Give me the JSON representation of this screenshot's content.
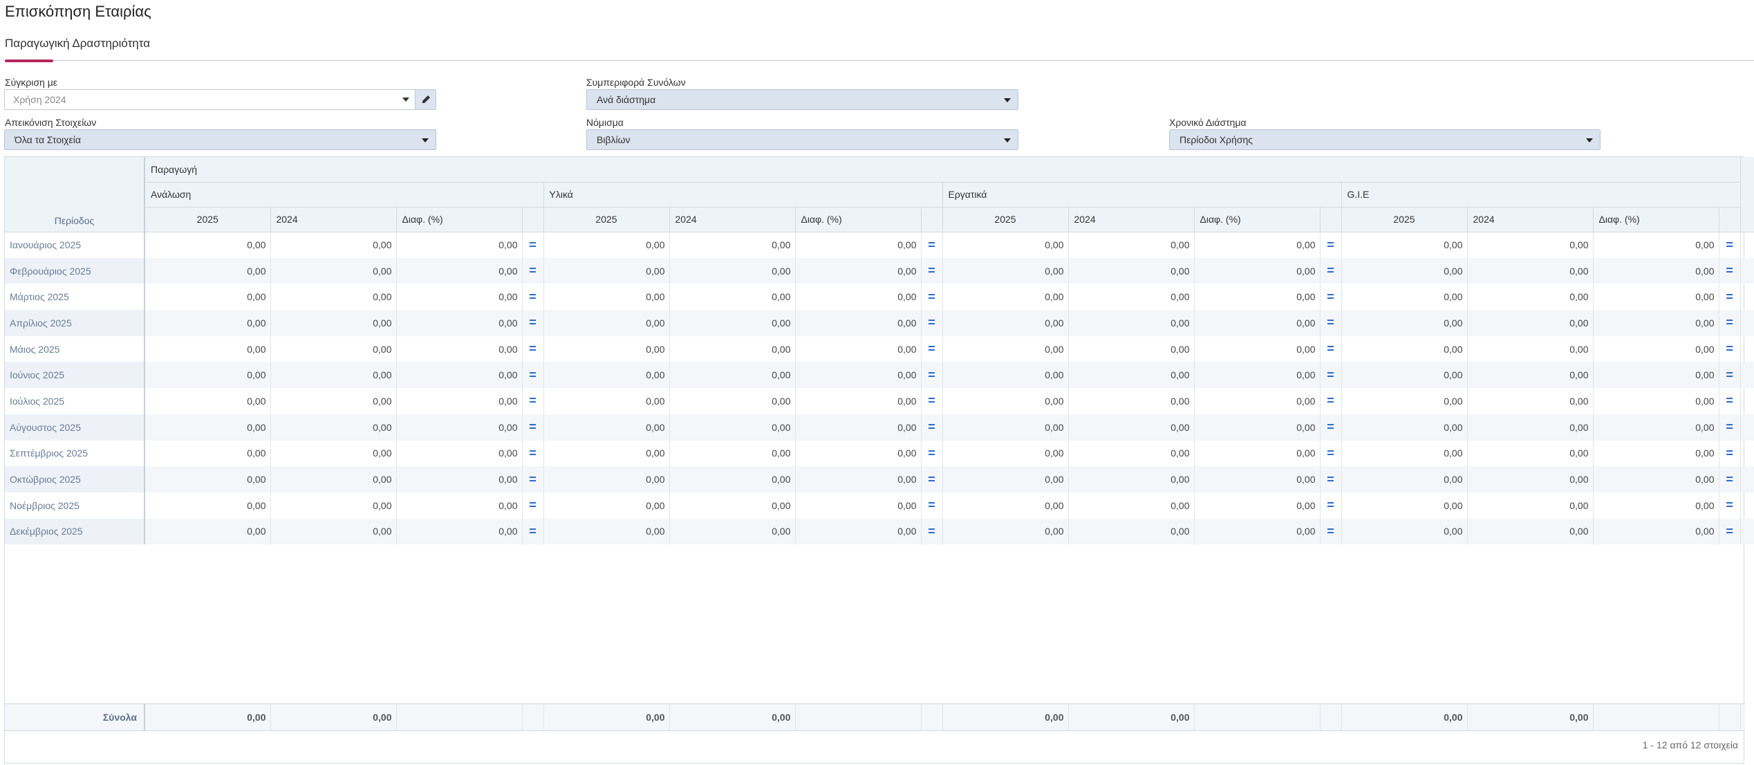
{
  "page_title": "Επισκόπηση Εταιρίας",
  "tab": "Παραγωγική Δραστηριότητα",
  "filters": {
    "compare_label": "Σύγκριση με",
    "compare_value": "Χρήση 2024",
    "totals_behavior_label": "Συμπεριφορά Συνόλων",
    "totals_behavior_value": "Ανά διάστημα",
    "display_items_label": "Απεικόνιση Στοιχείων",
    "display_items_value": "Όλα τα Στοιχεία",
    "currency_label": "Νόμισμα",
    "currency_value": "Βιβλίων",
    "period_label": "Χρονικό Διάστημα",
    "period_value": "Περίοδοι Χρήσης"
  },
  "grid": {
    "group": "Παραγωγή",
    "period_header": "Περίοδος",
    "sections": [
      "Ανάλωση",
      "Υλικά",
      "Εργατικά",
      "G.I.E"
    ],
    "columns": [
      "2025",
      "2024",
      "Διαφ. (%)"
    ],
    "rows": [
      {
        "period": "Ιανουάριος 2025"
      },
      {
        "period": "Φεβρουάριος 2025"
      },
      {
        "period": "Μάρτιος 2025"
      },
      {
        "period": "Απρίλιος 2025"
      },
      {
        "period": "Μάιος 2025"
      },
      {
        "period": "Ιούνιος 2025"
      },
      {
        "period": "Ιούλιος 2025"
      },
      {
        "period": "Αύγουστος 2025"
      },
      {
        "period": "Σεπτέμβριος 2025"
      },
      {
        "period": "Οκτώβριος 2025"
      },
      {
        "period": "Νοέμβριος 2025"
      },
      {
        "period": "Δεκέμβριος 2025"
      }
    ],
    "cell_value": "0,00",
    "equal_symbol": "=",
    "totals_label": "Σύνολα",
    "total_value": "0,00",
    "pager": "1 - 12 από 12 στοιχεία"
  }
}
